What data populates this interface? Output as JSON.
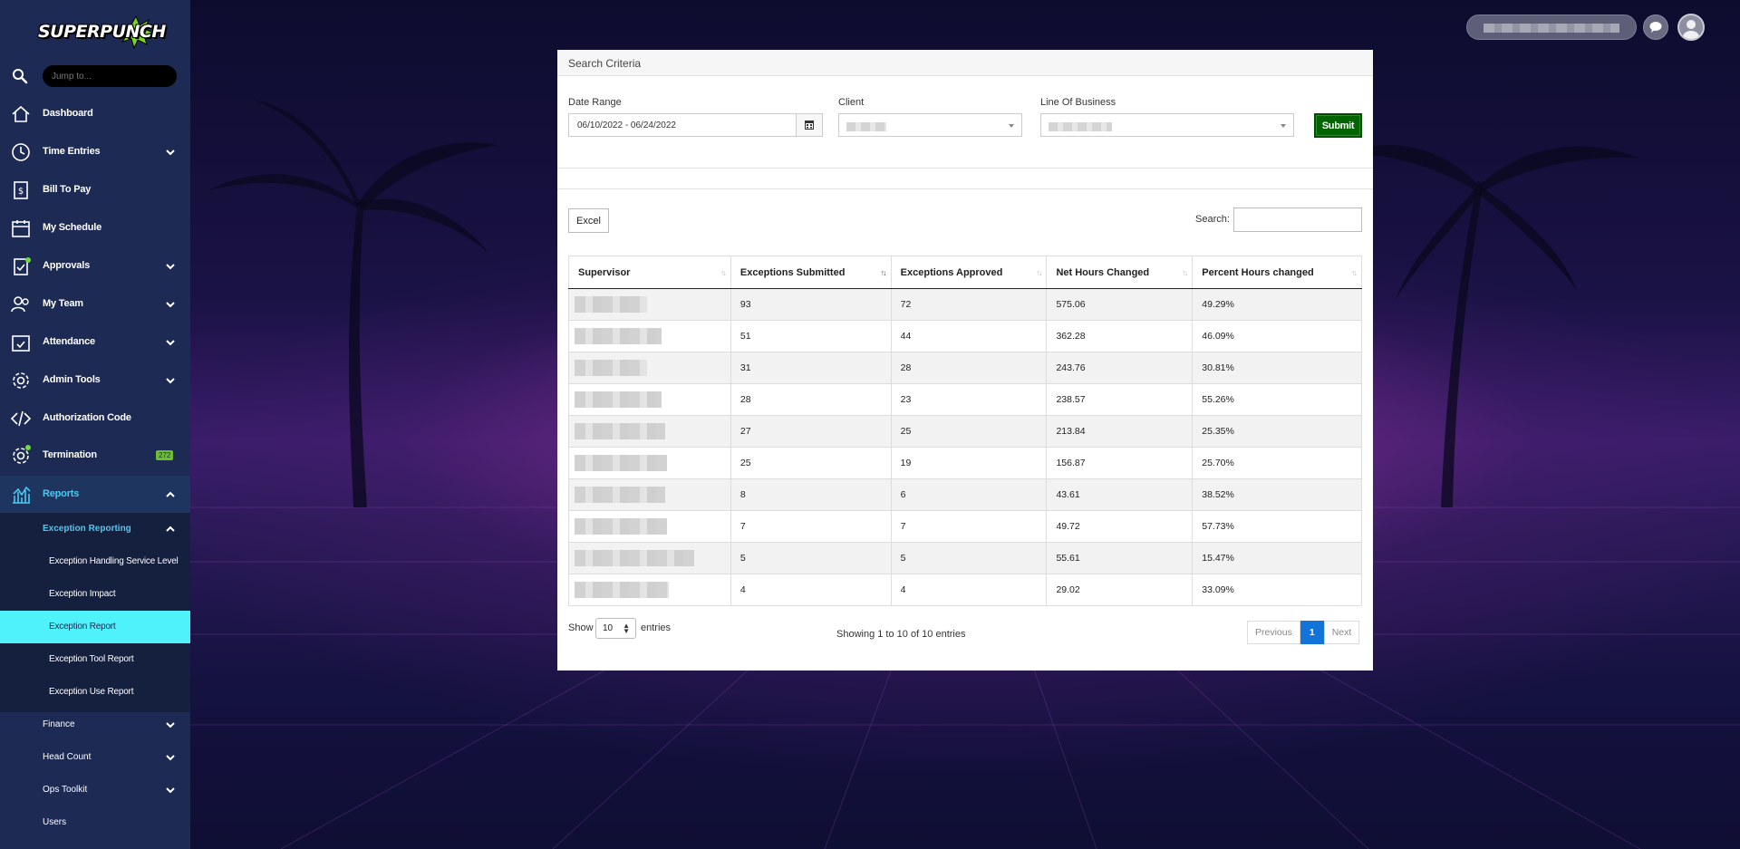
{
  "app": {
    "logo_text": "SUPERPUNCH",
    "jump_placeholder": "Jump to..."
  },
  "sidebar": {
    "items": [
      {
        "label": "Dashboard",
        "icon": "home-icon"
      },
      {
        "label": "Time Entries",
        "icon": "clock-icon"
      },
      {
        "label": "Bill To Pay",
        "icon": "bill-icon"
      },
      {
        "label": "My Schedule",
        "icon": "calendar-icon"
      },
      {
        "label": "Approvals",
        "icon": "clipboard-check-icon"
      },
      {
        "label": "My Team",
        "icon": "team-icon"
      },
      {
        "label": "Attendance",
        "icon": "calendar-check-icon"
      },
      {
        "label": "Admin Tools",
        "icon": "gear-icon"
      },
      {
        "label": "Authorization Code",
        "icon": "code-icon"
      },
      {
        "label": "Termination",
        "icon": "gear-alert-icon",
        "badge": "272"
      },
      {
        "label": "Reports",
        "icon": "chart-icon"
      }
    ],
    "reports_sub": {
      "section": "Exception Reporting",
      "items": [
        "Exception Handling Service Level",
        "Exception Impact",
        "Exception Report",
        "Exception Tool Report",
        "Exception Use Report"
      ],
      "selected": "Exception Report"
    },
    "lower_items": [
      "Finance",
      "Head Count",
      "Ops Toolkit",
      "Users"
    ]
  },
  "search_criteria": {
    "title": "Search Criteria",
    "date_range_label": "Date Range",
    "date_range_value": "06/10/2022 - 06/24/2022",
    "client_label": "Client",
    "lob_label": "Line Of Business",
    "submit_label": "Submit"
  },
  "table": {
    "excel_label": "Excel",
    "search_label": "Search:",
    "columns": [
      "Supervisor",
      "Exceptions Submitted",
      "Exceptions Approved",
      "Net Hours Changed",
      "Percent Hours changed"
    ],
    "rows": [
      [
        "93",
        "72",
        "575.06",
        "49.29%"
      ],
      [
        "51",
        "44",
        "362.28",
        "46.09%"
      ],
      [
        "31",
        "28",
        "243.76",
        "30.81%"
      ],
      [
        "28",
        "23",
        "238.57",
        "55.26%"
      ],
      [
        "27",
        "25",
        "213.84",
        "25.35%"
      ],
      [
        "25",
        "19",
        "156.87",
        "25.70%"
      ],
      [
        "8",
        "6",
        "43.61",
        "38.52%"
      ],
      [
        "7",
        "7",
        "49.72",
        "57.73%"
      ],
      [
        "5",
        "5",
        "55.61",
        "15.47%"
      ],
      [
        "4",
        "4",
        "29.02",
        "33.09%"
      ]
    ],
    "show_label": "Show",
    "page_length": "10",
    "entries_label": "entries",
    "info": "Showing 1 to 10 of 10 entries",
    "prev_label": "Previous",
    "current_page": "1",
    "next_label": "Next"
  },
  "colors": {
    "sidebar_bg": "#1d2a54",
    "accent_cyan": "#4ff1fb",
    "submit_green": "#006400",
    "page_blue": "#1273d8",
    "badge_green": "#6cbf2e"
  }
}
